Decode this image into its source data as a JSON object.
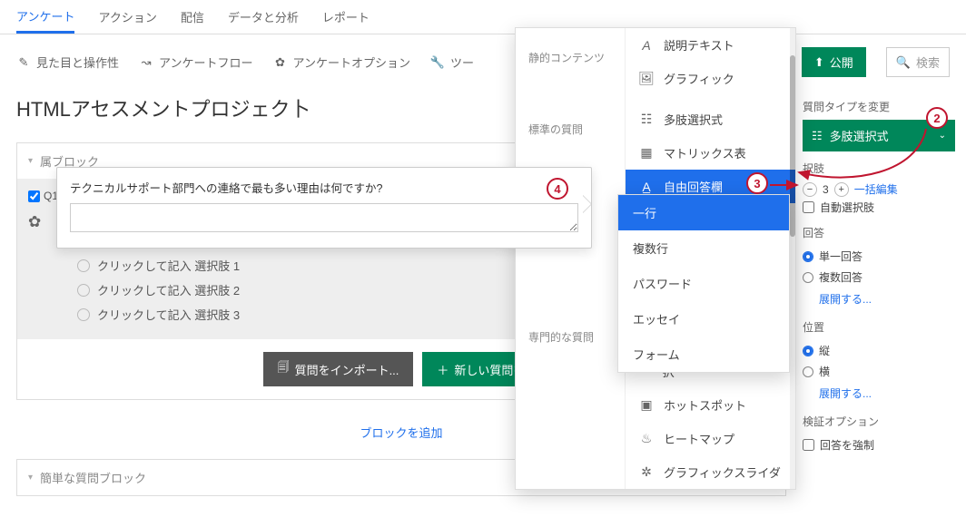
{
  "tabs": {
    "survey": "アンケート",
    "actions": "アクション",
    "distribute": "配信",
    "data": "データと分析",
    "reports": "レポート"
  },
  "toolbar": {
    "look": "見た目と操作性",
    "flow": "アンケートフロー",
    "options": "アンケートオプション",
    "tools": "ツー",
    "publish": "公開",
    "search_ph": "検索"
  },
  "page_title": "HTMLアセスメントプロジェク卜",
  "block1": {
    "header": "属ブロック",
    "q_id": "Q1",
    "q_text": "テクニカルサポート部門への連絡で最も多い理由は何ですか?",
    "choices": [
      "クリックして記入 選択肢 1",
      "クリックして記入 選択肢 2",
      "クリックして記入 選択肢 3"
    ],
    "import_btn": "質問をインポート...",
    "new_q_btn": "新しい質問を"
  },
  "add_block": "ブロックを追加",
  "block2_header": "簡単な質問ブロック",
  "qtype_groups": [
    "静的コンテンツ",
    "標準の質問",
    "専門的な質問"
  ],
  "qtype_options": [
    "説明テキスト",
    "グラフィック",
    "多肢選択式",
    "マトリックス表",
    "自由回答欄",
    "グループとランクの選択",
    "ホットスポット",
    "ヒートマップ",
    "グラフィックスライダ"
  ],
  "submenu": [
    "一行",
    "複数行",
    "パスワード",
    "エッセイ",
    "フォーム"
  ],
  "sidebar": {
    "change_type": "質問タイプを変更",
    "selected_type": "多肢選択式",
    "choices_label": "択肢",
    "choice_count": "3",
    "bulk_edit": "一括編集",
    "auto_choice": "自動選択肢",
    "answer_label": "回答",
    "single": "単一回答",
    "multi": "複数回答",
    "expand": "展開する...",
    "position_label": "位置",
    "vertical": "縦",
    "horizontal": "横",
    "validation_label": "検証オプション",
    "force": "回答を強制"
  },
  "callouts": {
    "c2": "2",
    "c3": "3",
    "c4": "4"
  }
}
